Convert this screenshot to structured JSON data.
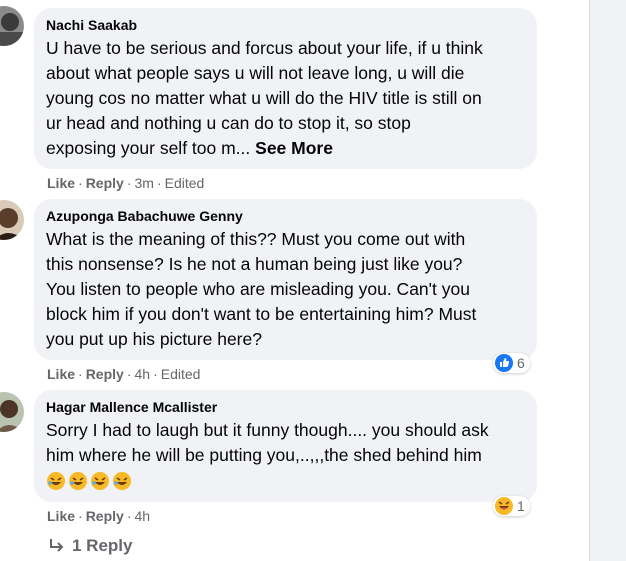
{
  "comments": [
    {
      "author": "Nachi Saakab",
      "text_lines": [
        "U have to be serious and forcus about your life, if u think",
        "about what people says u will not leave long, u will die",
        "young cos no matter what u will do the HIV title is still on",
        "ur head and nothing u can do to stop it, so stop",
        "exposing your self too m... "
      ],
      "see_more": "See More",
      "like": "Like",
      "reply": "Reply",
      "time": "3m",
      "edited": "Edited"
    },
    {
      "author": "Azuponga Babachuwe Genny",
      "text_lines": [
        "What is the meaning of this?? Must you come out with",
        "this nonsense? Is he not a human being just like you?",
        "You listen to people who are misleading you. Can't you",
        "block him if you don't want to be entertaining him? Must",
        "you put up his picture here?"
      ],
      "like": "Like",
      "reply": "Reply",
      "time": "4h",
      "edited": "Edited",
      "reaction_icon": "like-icon",
      "reaction_count": "6"
    },
    {
      "author": "Hagar Mallence Mcallister",
      "text_lines": [
        "Sorry I had to laugh but it funny though.... you should ask",
        "him where he will be putting you,..,,,the shed behind him"
      ],
      "emojis": [
        "rofl-emoji",
        "rofl-emoji",
        "rofl-emoji",
        "rofl-emoji"
      ],
      "like": "Like",
      "reply": "Reply",
      "time": "4h",
      "reaction_icon": "haha-icon",
      "reaction_count": "1"
    }
  ],
  "reply_link": {
    "arrow_icon": "reply-arrow-icon",
    "label": "1 Reply"
  },
  "colors": {
    "bubble": "#f0f2f5",
    "meta": "#65676b",
    "like_blue": "#1877f2",
    "haha_yellow": "#f7b928"
  }
}
